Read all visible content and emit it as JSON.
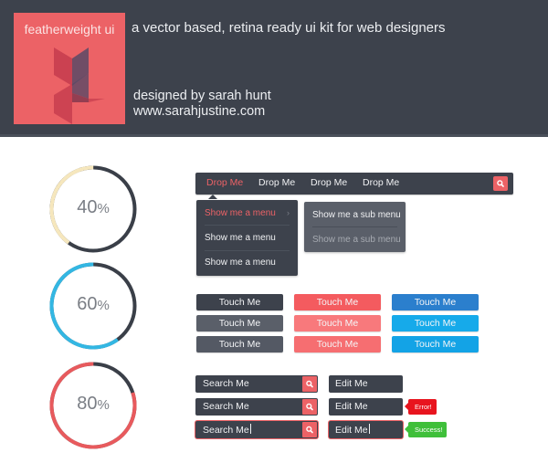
{
  "header": {
    "logo_title": "featherweight ui",
    "tagline": "a vector based, retina ready ui kit for web designers",
    "designer": "designed by sarah hunt",
    "website": "www.sarahjustine.com"
  },
  "colors": {
    "dark": "#3d424c",
    "accent_red": "#ec6266",
    "track_dark": "#3a3f48",
    "cream": "#f6e7bd",
    "sky": "#33b7e3",
    "coral": "#e85a5d"
  },
  "progress_rings": [
    {
      "value": 40,
      "number": "40",
      "unit": "%",
      "color": "#f6e7bd"
    },
    {
      "value": 60,
      "number": "60",
      "unit": "%",
      "color": "#33b7e3"
    },
    {
      "value": 80,
      "number": "80",
      "unit": "%",
      "color": "#e85a5d"
    }
  ],
  "navbar": {
    "items": [
      {
        "label": "Drop Me",
        "active": true
      },
      {
        "label": "Drop Me",
        "active": false
      },
      {
        "label": "Drop Me",
        "active": false
      },
      {
        "label": "Drop Me",
        "active": false
      }
    ],
    "search_icon": "search-icon"
  },
  "dropdown_menu": {
    "items": [
      {
        "label": "Show me a menu",
        "active": true,
        "has_submenu": true
      },
      {
        "label": "Show me a menu",
        "active": false
      },
      {
        "label": "Show me a menu",
        "active": false
      }
    ],
    "submenu_arrow": "›"
  },
  "submenu": {
    "items": [
      {
        "label": "Show me a  sub menu",
        "muted": false
      },
      {
        "label": "Show me a sub menu",
        "muted": true
      }
    ]
  },
  "buttons": {
    "label": "Touch Me",
    "columns": [
      {
        "name": "dark",
        "states": [
          {
            "label": "Touch Me",
            "color": "#3d424c"
          },
          {
            "label": "Touch Me",
            "color": "#5a5f69"
          },
          {
            "label": "Touch Me",
            "color": "#545964"
          }
        ]
      },
      {
        "name": "red",
        "states": [
          {
            "label": "Touch Me",
            "color": "#f45b5f"
          },
          {
            "label": "Touch Me",
            "color": "#f8797c"
          },
          {
            "label": "Touch Me",
            "color": "#f66e71"
          }
        ]
      },
      {
        "name": "blue",
        "states": [
          {
            "label": "Touch Me",
            "color": "#2b7fcd"
          },
          {
            "label": "Touch Me",
            "color": "#16aaea"
          },
          {
            "label": "Touch Me",
            "color": "#13a3e6"
          }
        ]
      }
    ]
  },
  "search_fields": [
    {
      "value": "Search Me",
      "focused": false
    },
    {
      "value": "Search Me",
      "focused": false
    },
    {
      "value": "Search Me",
      "focused": true
    }
  ],
  "edit_fields": [
    {
      "value": "Edit Me",
      "focused": false
    },
    {
      "value": "Edit Me",
      "focused": false,
      "badge": {
        "text": "Error!",
        "color": "#e8141e"
      }
    },
    {
      "value": "Edit Me",
      "focused": true,
      "badge": {
        "text": "Success!",
        "color": "#3fbf3a"
      }
    }
  ]
}
